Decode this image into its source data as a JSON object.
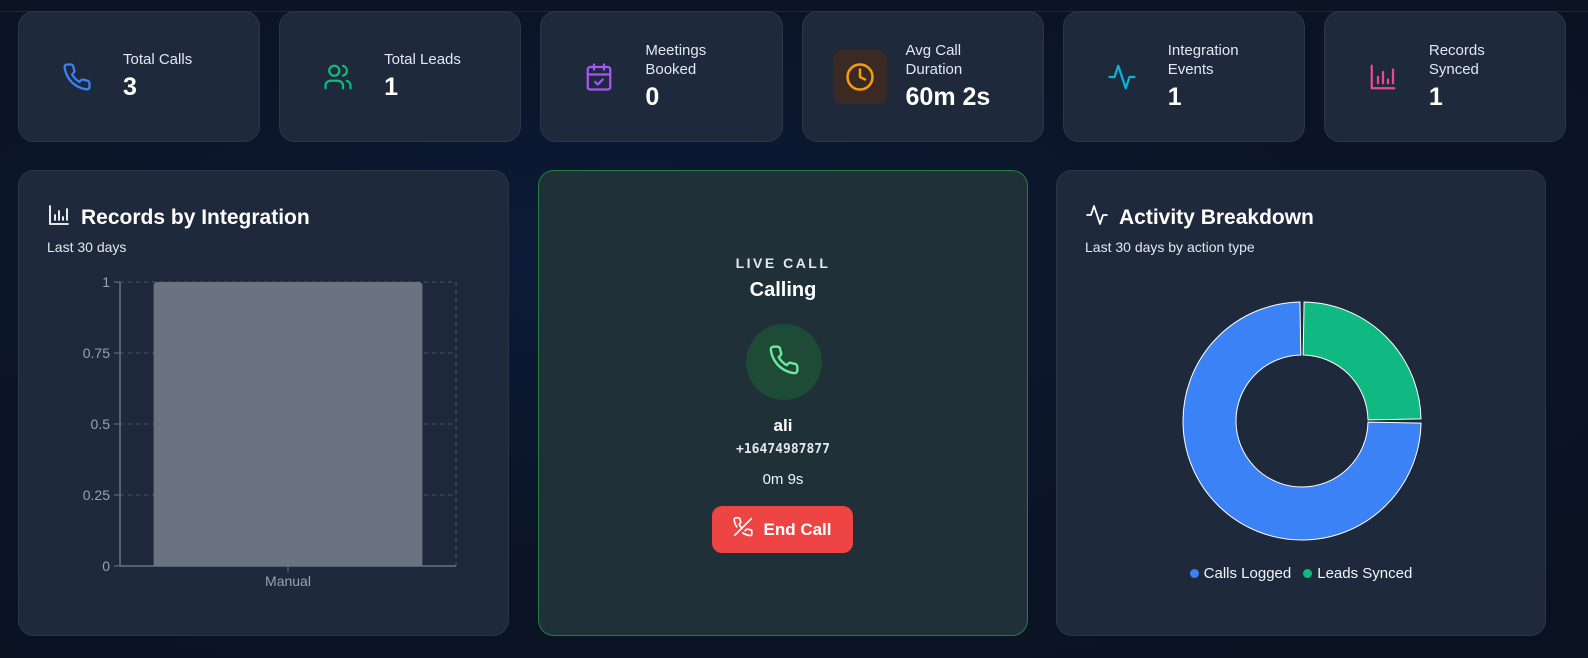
{
  "stats": [
    {
      "label": "Total Calls",
      "value": "3",
      "icon": "phone-icon",
      "color": "#3b82f6"
    },
    {
      "label": "Total Leads",
      "value": "1",
      "icon": "users-icon",
      "color": "#10b981"
    },
    {
      "label": "Meetings Booked",
      "value": "0",
      "icon": "calendar-check-icon",
      "color": "#a855f7"
    },
    {
      "label": "Avg Call Duration",
      "value": "60m 2s",
      "icon": "clock-icon",
      "color": "#f59e0b"
    },
    {
      "label": "Integration Events",
      "value": "1",
      "icon": "activity-icon",
      "color": "#06b6d4"
    },
    {
      "label": "Records Synced",
      "value": "1",
      "icon": "bar-chart-icon",
      "color": "#ec4899"
    }
  ],
  "records_card": {
    "title": "Records by Integration",
    "subtitle": "Last 30 days"
  },
  "live_call": {
    "tag": "LIVE CALL",
    "status": "Calling",
    "name": "ali",
    "phone": "+16474987877",
    "timer": "0m 9s",
    "end_label": "End Call"
  },
  "activity_card": {
    "title": "Activity Breakdown",
    "subtitle": "Last 30 days by action type"
  },
  "chart_data": [
    {
      "type": "bar",
      "categories": [
        "Manual"
      ],
      "values": [
        1
      ],
      "ylim": [
        0,
        1
      ],
      "yticks": [
        "0",
        "0.25",
        "0.5",
        "0.75",
        "1"
      ],
      "grid": true,
      "bar_color": "#6b7280"
    },
    {
      "type": "pie",
      "donut": true,
      "series": [
        {
          "name": "Calls Logged",
          "value": 3,
          "color": "#3b82f6"
        },
        {
          "name": "Leads Synced",
          "value": 1,
          "color": "#10b981"
        }
      ],
      "legend": "bottom"
    }
  ]
}
